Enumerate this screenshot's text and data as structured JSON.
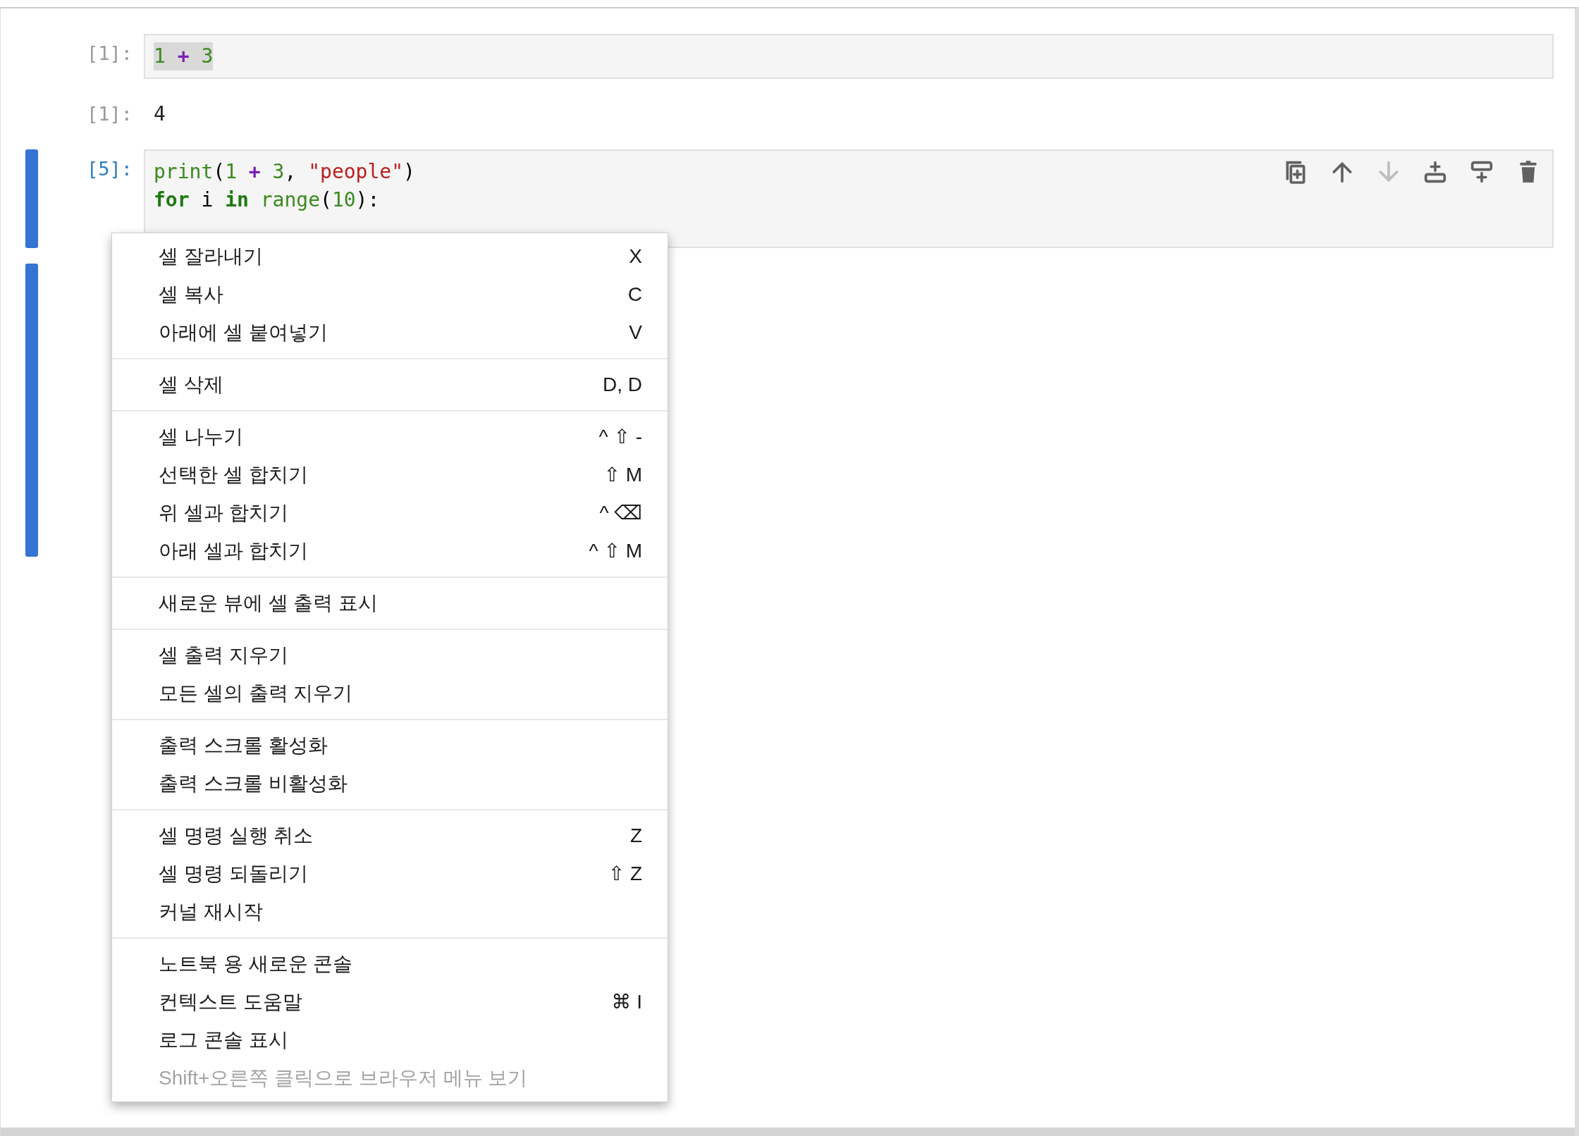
{
  "cells": [
    {
      "kind": "input",
      "prompt": "[1]:",
      "active": false,
      "lines": [
        {
          "highlighted": true,
          "tokens": [
            {
              "text": "1",
              "kind": "num"
            },
            {
              "text": " + ",
              "kind": "op"
            },
            {
              "text": "3",
              "kind": "num"
            }
          ]
        }
      ]
    },
    {
      "kind": "output",
      "prompt": "[1]:",
      "active": false,
      "text": "4"
    },
    {
      "kind": "input",
      "prompt": "[5]:",
      "active": true,
      "lines": [
        {
          "highlighted": false,
          "tokens": [
            {
              "text": "print",
              "kind": "builtin"
            },
            {
              "text": "(",
              "kind": "plain"
            },
            {
              "text": "1",
              "kind": "num"
            },
            {
              "text": " + ",
              "kind": "op"
            },
            {
              "text": "3",
              "kind": "num"
            },
            {
              "text": ", ",
              "kind": "plain"
            },
            {
              "text": "\"people\"",
              "kind": "str"
            },
            {
              "text": ")",
              "kind": "plain"
            }
          ]
        },
        {
          "highlighted": false,
          "tokens": [
            {
              "text": "for",
              "kind": "kw"
            },
            {
              "text": " i ",
              "kind": "plain"
            },
            {
              "text": "in",
              "kind": "kw"
            },
            {
              "text": " range",
              "kind": "builtin"
            },
            {
              "text": "(",
              "kind": "plain"
            },
            {
              "text": "10",
              "kind": "num"
            },
            {
              "text": "):",
              "kind": "plain"
            }
          ]
        }
      ],
      "toolbar": [
        {
          "kind": "duplicate",
          "disabled": false
        },
        {
          "kind": "up",
          "disabled": false
        },
        {
          "kind": "down",
          "disabled": true
        },
        {
          "kind": "insert-above",
          "disabled": false
        },
        {
          "kind": "insert-below",
          "disabled": false
        },
        {
          "kind": "delete",
          "disabled": false
        }
      ]
    },
    {
      "kind": "output",
      "active": true
    }
  ],
  "context_menu": {
    "groups": [
      [
        {
          "label": "셀 잘라내기",
          "shortcut": "X",
          "disabled": false
        },
        {
          "label": "셀 복사",
          "shortcut": "C",
          "disabled": false
        },
        {
          "label": "아래에 셀 붙여넣기",
          "shortcut": "V",
          "disabled": false
        }
      ],
      [
        {
          "label": "셀 삭제",
          "shortcut": "D, D",
          "disabled": false
        }
      ],
      [
        {
          "label": "셀 나누기",
          "shortcut": "^ ⇧ -",
          "disabled": false
        },
        {
          "label": "선택한 셀 합치기",
          "shortcut": "⇧ M",
          "disabled": false
        },
        {
          "label": "위 셀과 합치기",
          "shortcut": "^ ⌫",
          "disabled": false
        },
        {
          "label": "아래 셀과 합치기",
          "shortcut": "^ ⇧ M",
          "disabled": false
        }
      ],
      [
        {
          "label": "새로운 뷰에 셀 출력 표시",
          "disabled": false
        }
      ],
      [
        {
          "label": "셀 출력 지우기",
          "disabled": false
        },
        {
          "label": "모든 셀의 출력 지우기",
          "disabled": false
        }
      ],
      [
        {
          "label": "출력 스크롤 활성화",
          "disabled": false
        },
        {
          "label": "출력 스크롤 비활성화",
          "disabled": false
        }
      ],
      [
        {
          "label": "셀 명령 실행 취소",
          "shortcut": "Z",
          "disabled": false
        },
        {
          "label": "셀 명령 되돌리기",
          "shortcut": "⇧ Z",
          "disabled": false
        },
        {
          "label": "커널 재시작",
          "disabled": false
        }
      ],
      [
        {
          "label": "노트북 용 새로운 콘솔",
          "disabled": false
        },
        {
          "label": "컨텍스트 도움말",
          "shortcut": "⌘ I",
          "disabled": false
        },
        {
          "label": "로그 콘솔 표시",
          "disabled": false
        },
        {
          "label": "Shift+오른쪽 클릭으로 브라우저 메뉴 보기",
          "disabled": true
        }
      ]
    ]
  }
}
